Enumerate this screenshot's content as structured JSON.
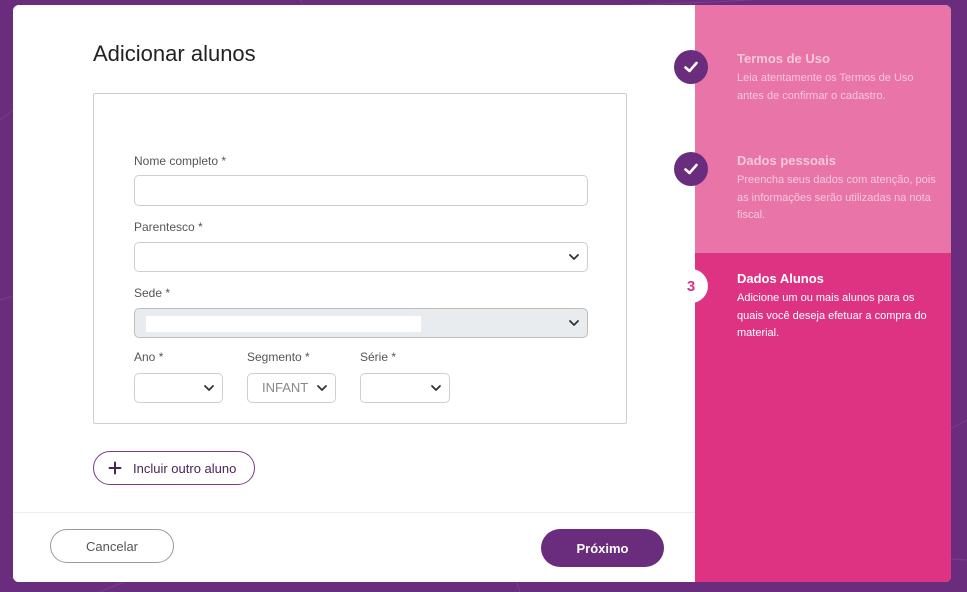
{
  "page": {
    "title": "Adicionar alunos"
  },
  "form": {
    "nome": {
      "label": "Nome completo",
      "required": "*",
      "value": "",
      "placeholder": ""
    },
    "parentesco": {
      "label": "Parentesco",
      "required": "*",
      "value": ""
    },
    "sede": {
      "label": "Sede",
      "required": "*",
      "value": ""
    },
    "ano": {
      "label": "Ano",
      "required": "*",
      "value": ""
    },
    "segmento": {
      "label": "Segmento",
      "required": "*",
      "value": "INFANT"
    },
    "serie": {
      "label": "Série",
      "required": "*",
      "value": ""
    },
    "add_button_label": "Incluir outro aluno"
  },
  "footer": {
    "cancel_label": "Cancelar",
    "next_label": "Próximo"
  },
  "steps": [
    {
      "title": "Termos de Uso",
      "description": "Leia atentamente os Termos de Uso antes de confirmar o cadastro.",
      "state": "done"
    },
    {
      "title": "Dados pessoais",
      "description": "Preencha seus dados com atenção, pois as informações serão utilizadas na nota fiscal.",
      "state": "done"
    },
    {
      "number": "3",
      "title": "Dados Alunos",
      "description": "Adicione um ou mais alunos para os quais você deseja efetuar a compra do material.",
      "state": "current"
    }
  ],
  "colors": {
    "brand_purple": "#6a2c7c",
    "sidebar_light_pink": "#e874a8",
    "sidebar_active_pink": "#dd3382"
  },
  "icons": {
    "check": "check-icon",
    "plus": "plus-icon",
    "dropdown": "chevron-down-icon"
  }
}
